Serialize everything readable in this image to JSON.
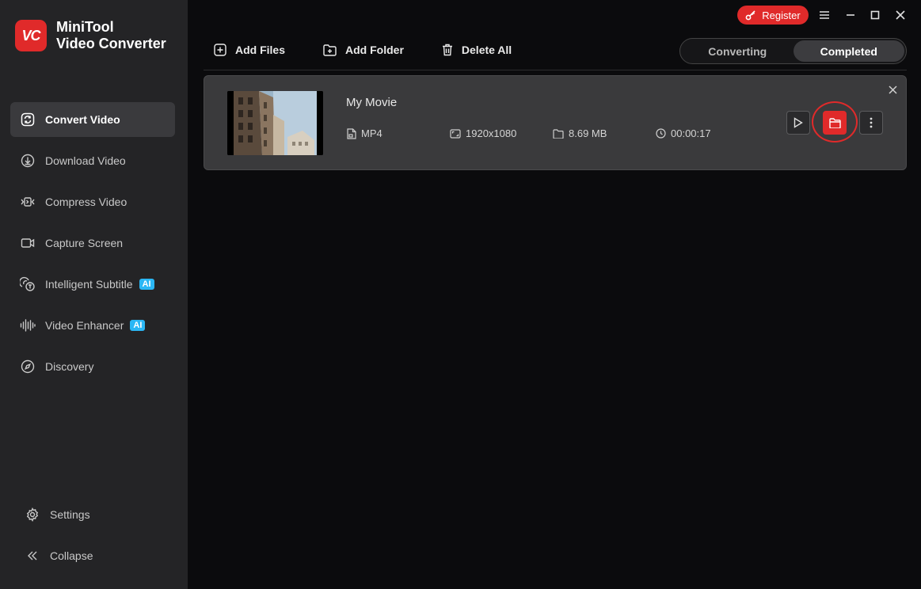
{
  "app": {
    "name_line1": "MiniTool",
    "name_line2": "Video Converter",
    "logo_text": "VC",
    "accent_color": "#e02a2a"
  },
  "titlebar": {
    "register_label": "Register"
  },
  "sidebar": {
    "items": [
      {
        "label": "Convert Video",
        "icon": "convert-icon",
        "active": true
      },
      {
        "label": "Download Video",
        "icon": "download-icon"
      },
      {
        "label": "Compress Video",
        "icon": "compress-icon"
      },
      {
        "label": "Capture Screen",
        "icon": "camera-icon"
      },
      {
        "label": "Intelligent Subtitle",
        "icon": "subtitle-icon",
        "badge": "AI"
      },
      {
        "label": "Video Enhancer",
        "icon": "waveform-icon",
        "badge": "AI"
      },
      {
        "label": "Discovery",
        "icon": "compass-icon"
      }
    ],
    "settings_label": "Settings",
    "collapse_label": "Collapse"
  },
  "toolbar": {
    "add_files": "Add Files",
    "add_folder": "Add Folder",
    "delete_all": "Delete All"
  },
  "tabs": {
    "converting": "Converting",
    "completed": "Completed",
    "active": "Completed"
  },
  "file": {
    "title": "My Movie",
    "format": "MP4",
    "resolution": "1920x1080",
    "size": "8.69 MB",
    "duration": "00:00:17"
  }
}
